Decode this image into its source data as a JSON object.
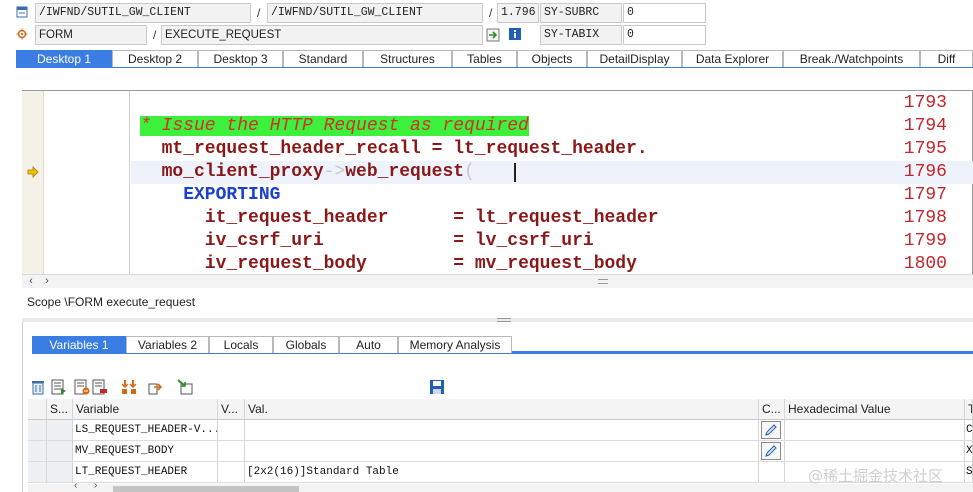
{
  "header": {
    "row1": {
      "program": "/IWFND/SUTIL_GW_CLIENT",
      "include": "/IWFND/SUTIL_GW_CLIENT",
      "line": "1.796",
      "sy_field": "SY-SUBRC",
      "sy_value": "0"
    },
    "row2": {
      "event_type": "FORM",
      "event_name": "EXECUTE_REQUEST",
      "sy_field": "SY-TABIX",
      "sy_value": "0"
    },
    "slash": "/"
  },
  "desktop_tabs": [
    {
      "label": "Desktop 1",
      "active": true
    },
    {
      "label": "Desktop 2",
      "active": false
    },
    {
      "label": "Desktop 3",
      "active": false
    },
    {
      "label": "Standard",
      "active": false
    },
    {
      "label": "Structures",
      "active": false
    },
    {
      "label": "Tables",
      "active": false
    },
    {
      "label": "Objects",
      "active": false
    },
    {
      "label": "DetailDisplay",
      "active": false
    },
    {
      "label": "Data Explorer",
      "active": false
    },
    {
      "label": "Break./Watchpoints",
      "active": false
    },
    {
      "label": "Diff",
      "active": false
    }
  ],
  "code": {
    "line_numbers": [
      "1793",
      "1794",
      "1795",
      "1796",
      "1797",
      "1798",
      "1799",
      "1800"
    ],
    "current_line": "1796",
    "lines": {
      "l1794": "* Issue the HTTP Request as required",
      "l1795": "  mt_request_header_recall = lt_request_header.",
      "l1796_obj": "  mo_client_proxy",
      "l1796_arrow": "->",
      "l1796_meth": "web_request",
      "l1796_paren": "(",
      "l1797": "    EXPORTING",
      "l1798_name": "      it_request_header      ",
      "l1798_val": "= lt_request_header",
      "l1799_name": "      iv_csrf_uri            ",
      "l1799_val": "= lv_csrf_uri",
      "l1800_name": "      iv_request_body        ",
      "l1800_val": "= mv_request_body"
    }
  },
  "scope": "Scope \\FORM execute_request",
  "variable_tabs": [
    {
      "label": "Variables 1",
      "active": true
    },
    {
      "label": "Variables 2",
      "active": false
    },
    {
      "label": "Locals",
      "active": false
    },
    {
      "label": "Globals",
      "active": false
    },
    {
      "label": "Auto",
      "active": false
    },
    {
      "label": "Memory Analysis",
      "active": false
    }
  ],
  "toolbar_icons": [
    "delete-icon",
    "detail-view-icon",
    "new-entry-icon",
    "remove-entry-icon",
    "hierarchy-icon",
    "export-icon",
    "load-icon",
    "save-icon"
  ],
  "table": {
    "headers": [
      "S...",
      "Variable",
      "V...",
      "Val.",
      "C...",
      "Hexadecimal Value",
      "T"
    ],
    "rows": [
      {
        "variable": "LS_REQUEST_HEADER-V...",
        "value": "",
        "type": "C",
        "editable": true
      },
      {
        "variable": "MV_REQUEST_BODY",
        "value": "",
        "type": "X",
        "editable": true
      },
      {
        "variable": "LT_REQUEST_HEADER",
        "value": "[2x2(16)]Standard Table",
        "type": "S",
        "editable": false
      }
    ]
  },
  "watermark": "@稀土掘金技术社区",
  "colors": {
    "accent": "#3a7ee4",
    "comment_bg": "#3cf03c",
    "line_number": "#c0282d",
    "keyword": "#1a3fd1",
    "identifier": "#8b1818"
  }
}
